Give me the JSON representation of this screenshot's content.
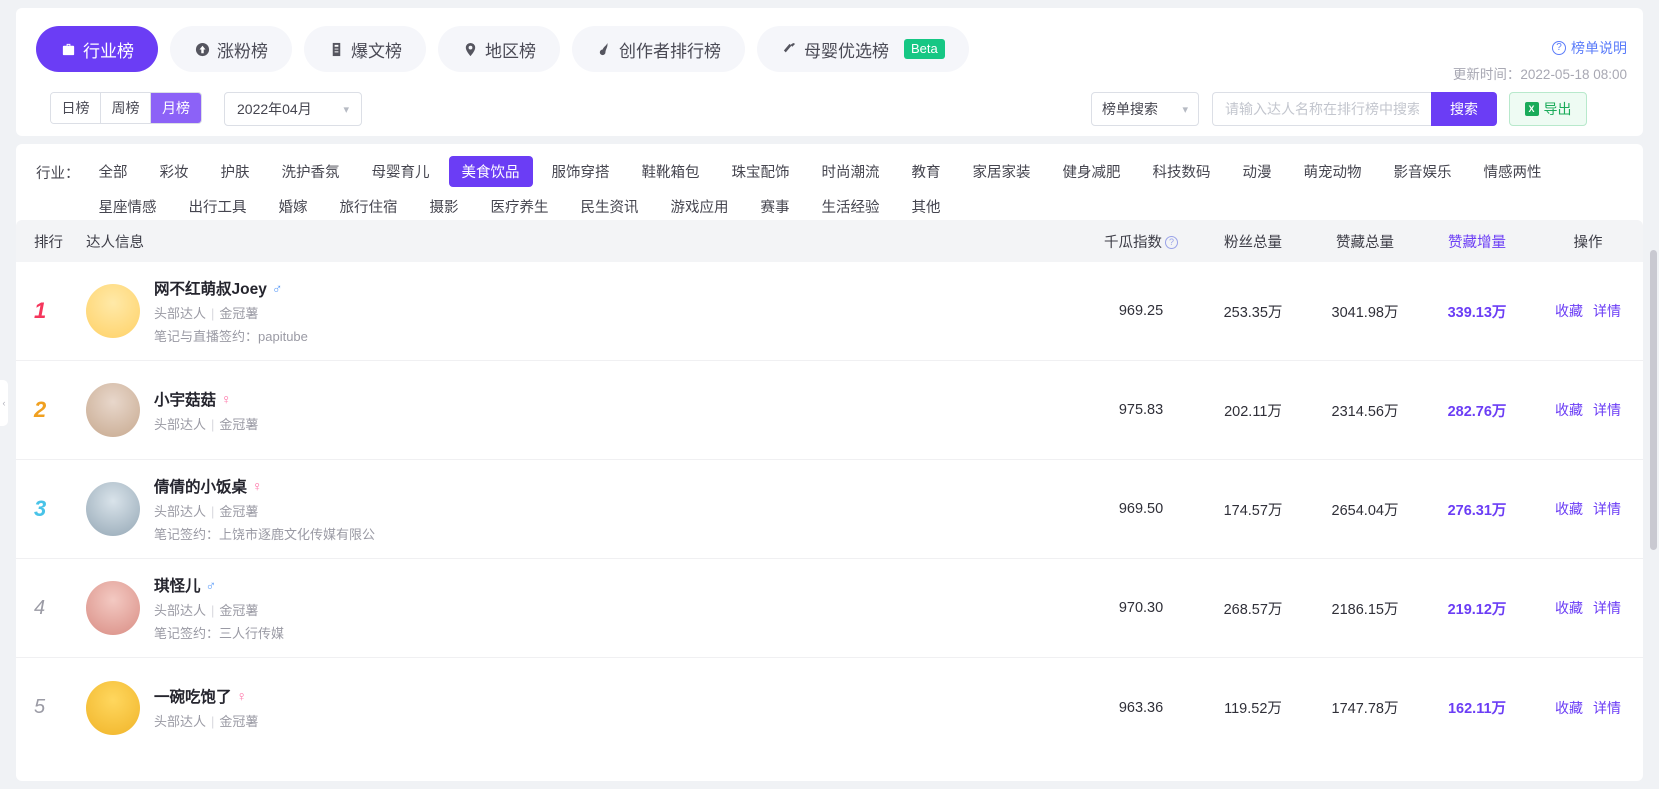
{
  "tabs": [
    {
      "label": "行业榜",
      "icon": "industry-icon",
      "active": true
    },
    {
      "label": "涨粉榜",
      "icon": "fans-growth-icon",
      "active": false
    },
    {
      "label": "爆文榜",
      "icon": "hot-article-icon",
      "active": false
    },
    {
      "label": "地区榜",
      "icon": "location-pin-icon",
      "active": false
    },
    {
      "label": "创作者排行榜",
      "icon": "creator-icon",
      "active": false
    },
    {
      "label": "母婴优选榜",
      "icon": "mother-baby-icon",
      "active": false,
      "badge": "Beta"
    }
  ],
  "header": {
    "help_label": "榜单说明",
    "update_time": "更新时间：2022-05-18 08:00"
  },
  "filters": {
    "period": [
      {
        "label": "日榜",
        "active": false
      },
      {
        "label": "周榜",
        "active": false
      },
      {
        "label": "月榜",
        "active": true
      }
    ],
    "date_value": "2022年04月",
    "rank_select_value": "榜单搜索",
    "search_placeholder": "请输入达人名称在排行榜中搜索",
    "search_value": "",
    "search_button": "搜索",
    "export_button": "导出"
  },
  "industry": {
    "label": "行业：",
    "tags": [
      {
        "label": "全部",
        "active": false
      },
      {
        "label": "彩妆",
        "active": false
      },
      {
        "label": "护肤",
        "active": false
      },
      {
        "label": "洗护香氛",
        "active": false
      },
      {
        "label": "母婴育儿",
        "active": false
      },
      {
        "label": "美食饮品",
        "active": true
      },
      {
        "label": "服饰穿搭",
        "active": false
      },
      {
        "label": "鞋靴箱包",
        "active": false
      },
      {
        "label": "珠宝配饰",
        "active": false
      },
      {
        "label": "时尚潮流",
        "active": false
      },
      {
        "label": "教育",
        "active": false
      },
      {
        "label": "家居家装",
        "active": false
      },
      {
        "label": "健身减肥",
        "active": false
      },
      {
        "label": "科技数码",
        "active": false
      },
      {
        "label": "动漫",
        "active": false
      },
      {
        "label": "萌宠动物",
        "active": false
      },
      {
        "label": "影音娱乐",
        "active": false
      },
      {
        "label": "情感两性",
        "active": false
      },
      {
        "label": "星座情感",
        "active": false
      },
      {
        "label": "出行工具",
        "active": false
      },
      {
        "label": "婚嫁",
        "active": false
      },
      {
        "label": "旅行住宿",
        "active": false
      },
      {
        "label": "摄影",
        "active": false
      },
      {
        "label": "医疗养生",
        "active": false
      },
      {
        "label": "民生资讯",
        "active": false
      },
      {
        "label": "游戏应用",
        "active": false
      },
      {
        "label": "赛事",
        "active": false
      },
      {
        "label": "生活经验",
        "active": false
      },
      {
        "label": "其他",
        "active": false
      }
    ]
  },
  "table": {
    "columns": {
      "rank": "排行",
      "info": "达人信息",
      "index": "千瓜指数",
      "fans_total": "粉丝总量",
      "like_total": "赞藏总量",
      "like_growth": "赞藏增量",
      "action": "操作"
    },
    "action_labels": {
      "favorite": "收藏",
      "detail": "详情"
    },
    "rows": [
      {
        "rank": "1",
        "name": "网不红萌叔Joey",
        "gender": "♂",
        "gender_type": "male",
        "level": "头部达人",
        "crown": "金冠薯",
        "signature": "笔记与直播签约：papitube",
        "index": "969.25",
        "fans_total": "253.35万",
        "like_total": "3041.98万",
        "like_growth": "339.13万",
        "avatar_colors": [
          "#ffe9a8",
          "#ffd166"
        ]
      },
      {
        "rank": "2",
        "name": "小宇菇菇",
        "gender": "♀",
        "gender_type": "female",
        "level": "头部达人",
        "crown": "金冠薯",
        "signature": "",
        "index": "975.83",
        "fans_total": "202.11万",
        "like_total": "2314.56万",
        "like_growth": "282.76万",
        "avatar_colors": [
          "#e8d7cb",
          "#c7a98f"
        ]
      },
      {
        "rank": "3",
        "name": "倩倩的小饭桌",
        "gender": "♀",
        "gender_type": "female",
        "level": "头部达人",
        "crown": "金冠薯",
        "signature": "笔记签约：上饶市逐鹿文化传媒有限公",
        "index": "969.50",
        "fans_total": "174.57万",
        "like_total": "2654.04万",
        "like_growth": "276.31万",
        "avatar_colors": [
          "#d9e3ea",
          "#94a7b5"
        ]
      },
      {
        "rank": "4",
        "name": "琪怪儿",
        "gender": "♂",
        "gender_type": "male",
        "level": "头部达人",
        "crown": "金冠薯",
        "signature": "笔记签约：三人行传媒",
        "index": "970.30",
        "fans_total": "268.57万",
        "like_total": "2186.15万",
        "like_growth": "219.12万",
        "avatar_colors": [
          "#f3c9c2",
          "#d98d84"
        ]
      },
      {
        "rank": "5",
        "name": "一碗吃饱了",
        "gender": "♀",
        "gender_type": "female",
        "level": "头部达人",
        "crown": "金冠薯",
        "signature": "",
        "index": "963.36",
        "fans_total": "119.52万",
        "like_total": "1747.78万",
        "like_growth": "162.11万",
        "avatar_colors": [
          "#ffd75e",
          "#f0b429"
        ]
      }
    ]
  },
  "colors": {
    "brand": "#6b3df5",
    "accent_light": "#8c62f7",
    "green": "#1aab5a",
    "beta": "#16c784"
  }
}
